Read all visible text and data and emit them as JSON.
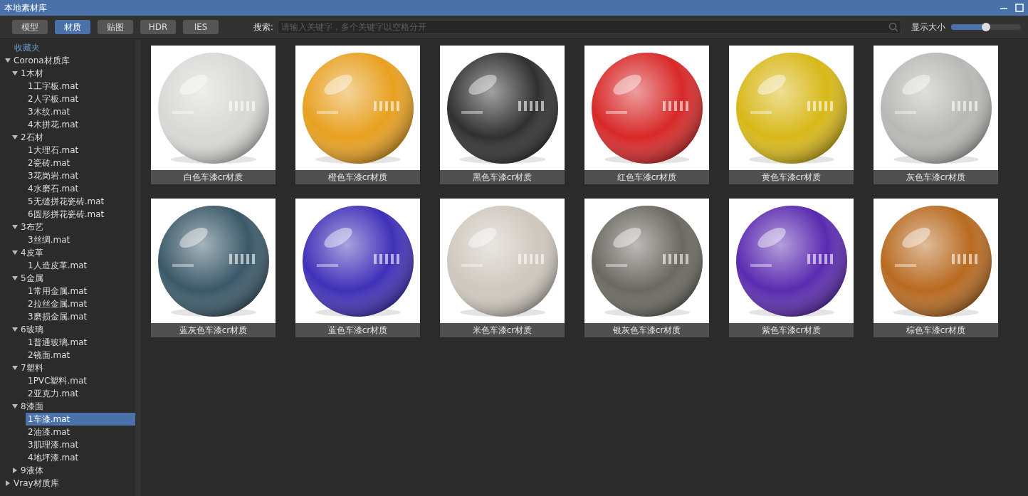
{
  "window": {
    "title": "本地素材库"
  },
  "tabs": [
    {
      "label": "模型",
      "selected": false
    },
    {
      "label": "材质",
      "selected": true
    },
    {
      "label": "贴图",
      "selected": false
    },
    {
      "label": "HDR",
      "selected": false
    },
    {
      "label": "IES",
      "selected": false
    }
  ],
  "search": {
    "label": "搜索:",
    "placeholder": "请输入关键字，多个关键字以空格分开"
  },
  "size_slider": {
    "label": "显示大小",
    "level": 0.5
  },
  "sidebar": {
    "favorites": "收藏夹",
    "tree": [
      {
        "label": "Corona材质库",
        "expanded": true,
        "selected": false,
        "children": [
          {
            "label": "1木材",
            "expanded": true,
            "selected": false,
            "children": [
              {
                "label": "1工字板.mat",
                "selected": false
              },
              {
                "label": "2人字板.mat",
                "selected": false
              },
              {
                "label": "3木纹.mat",
                "selected": false
              },
              {
                "label": "4木拼花.mat",
                "selected": false
              }
            ]
          },
          {
            "label": "2石材",
            "expanded": true,
            "selected": false,
            "children": [
              {
                "label": "1大理石.mat",
                "selected": false
              },
              {
                "label": "2瓷砖.mat",
                "selected": false
              },
              {
                "label": "3花岗岩.mat",
                "selected": false
              },
              {
                "label": "4水磨石.mat",
                "selected": false
              },
              {
                "label": "5无缝拼花瓷砖.mat",
                "selected": false
              },
              {
                "label": "6圆形拼花瓷砖.mat",
                "selected": false
              }
            ]
          },
          {
            "label": "3布艺",
            "expanded": true,
            "selected": false,
            "children": [
              {
                "label": "3丝绸.mat",
                "selected": false
              }
            ]
          },
          {
            "label": "4皮革",
            "expanded": true,
            "selected": false,
            "children": [
              {
                "label": "1人造皮革.mat",
                "selected": false
              }
            ]
          },
          {
            "label": "5金属",
            "expanded": true,
            "selected": false,
            "children": [
              {
                "label": "1常用金属.mat",
                "selected": false
              },
              {
                "label": "2拉丝金属.mat",
                "selected": false
              },
              {
                "label": "3磨损金属.mat",
                "selected": false
              }
            ]
          },
          {
            "label": "6玻璃",
            "expanded": true,
            "selected": false,
            "children": [
              {
                "label": "1普通玻璃.mat",
                "selected": false
              },
              {
                "label": "2镜面.mat",
                "selected": false
              }
            ]
          },
          {
            "label": "7塑料",
            "expanded": true,
            "selected": false,
            "children": [
              {
                "label": "1PVC塑料.mat",
                "selected": false
              },
              {
                "label": "2亚克力.mat",
                "selected": false
              }
            ]
          },
          {
            "label": "8漆面",
            "expanded": true,
            "selected": false,
            "children": [
              {
                "label": "1车漆.mat",
                "selected": true
              },
              {
                "label": "2油漆.mat",
                "selected": false
              },
              {
                "label": "3肌理漆.mat",
                "selected": false
              },
              {
                "label": "4地坪漆.mat",
                "selected": false
              }
            ]
          },
          {
            "label": "9液体",
            "expanded": false,
            "selected": false
          }
        ]
      },
      {
        "label": "Vray材质库",
        "expanded": false,
        "selected": false
      }
    ]
  },
  "materials": [
    {
      "name": "白色车漆cr材质",
      "color": "#d8d8d6"
    },
    {
      "name": "橙色车漆cr材质",
      "color": "#e8a020"
    },
    {
      "name": "黑色车漆cr材质",
      "color": "#303030"
    },
    {
      "name": "红色车漆cr材质",
      "color": "#d82828"
    },
    {
      "name": "黄色车漆cr材质",
      "color": "#d8b818"
    },
    {
      "name": "灰色车漆cr材质",
      "color": "#b8b8b6"
    },
    {
      "name": "蓝灰色车漆cr材质",
      "color": "#3a5868"
    },
    {
      "name": "蓝色车漆cr材质",
      "color": "#4030b8"
    },
    {
      "name": "米色车漆cr材质",
      "color": "#cfc8be"
    },
    {
      "name": "银灰色车漆cr材质",
      "color": "#6a6860"
    },
    {
      "name": "紫色车漆cr材质",
      "color": "#5a2ab0"
    },
    {
      "name": "棕色车漆cr材质",
      "color": "#b86a20"
    }
  ]
}
